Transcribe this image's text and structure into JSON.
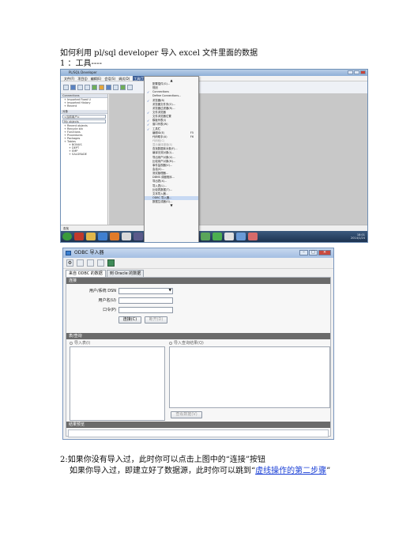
{
  "doc": {
    "title": "如何利用 pl/sql developer  导入 excel 文件里面的数据",
    "step1": "1 ：工具----",
    "step2": "2:如果你没有导入过，此时你可以点击上图中的“连接”按钮",
    "step2b_prefix": "如果你导入过，即建立好了数据源，此时你可以跳到“",
    "step2b_link": "虚线操作的第二步骤",
    "step2b_suffix": "”",
    "link_color": "#1a3fd6"
  },
  "plsql_window": {
    "title": "PL/SQL Developer",
    "menu": [
      "文件(F)",
      "项目(J)",
      "编辑(E)",
      "会话(S)",
      "调试(D)",
      "工具(T)",
      "报告(R)",
      "窗口(W)",
      "帮助(H)"
    ],
    "active_menu": "工具(T)",
    "left_panel": {
      "header": "Connections",
      "tree": [
        "Imported Fixed U",
        "Imported History",
        "Recent"
      ],
      "selector_header": "对象",
      "selector_value": "<当前用户>",
      "objects_header": "My objects",
      "object_tree": [
        "Recent objects",
        "Recycle bin",
        "Functions",
        "Procedures",
        "Packages",
        "Tables",
        "BONUS",
        "DEPT",
        "EMP",
        "SALGRADE"
      ]
    },
    "bottom_bar": "查找",
    "taskbar_time": "18:01",
    "taskbar_date": "2014/1/24",
    "tools_menu": [
      {
        "label": "配置插件(G)...",
        "checked": false
      },
      {
        "label": "规则",
        "checked": false
      },
      {
        "label": "Connections",
        "checked": true
      },
      {
        "label": "Define Connections...",
        "checked": false
      },
      {
        "label": "浏览器(B)",
        "checked": true
      },
      {
        "label": "浏览器文件夹(O)...",
        "checked": false
      },
      {
        "label": "浏览器过滤器(R)...",
        "checked": false
      },
      {
        "label": "文件浏览器",
        "checked": true
      },
      {
        "label": "文件浏览器位置",
        "checked": false
      },
      {
        "label": "模板列表(I)",
        "checked": true
      },
      {
        "label": "窗口列表(W)",
        "checked": true
      },
      {
        "label": "工具栏",
        "checked": true
      },
      {
        "label": "编辑ID(E)",
        "checked": false,
        "key": "F5"
      },
      {
        "label": "代码助手(A)",
        "checked": false,
        "key": "F6"
      },
      {
        "label": "代码段(C)",
        "checked": false,
        "grey": true
      },
      {
        "label": "显示编译错误(S)",
        "checked": false,
        "grey": true
      },
      {
        "label": "查找数据库对象(F)...",
        "checked": false
      },
      {
        "label": "编译无效对象(I)...",
        "checked": false
      },
      {
        "label": "导出用户对象(U)...",
        "checked": false
      },
      {
        "label": "比较用户对象(M)...",
        "checked": false
      },
      {
        "label": "事件监视器(V)...",
        "checked": false
      },
      {
        "label": "会话(S)...",
        "checked": false
      },
      {
        "label": "测试管理器...",
        "checked": false
      },
      {
        "label": "DBMS 调度程序...",
        "checked": false
      },
      {
        "label": "导出表(X)...",
        "checked": false
      },
      {
        "label": "导入表(L)...",
        "checked": false
      },
      {
        "label": "比较表数据(T)...",
        "checked": false
      },
      {
        "label": "文本导入器...",
        "checked": false
      },
      {
        "label": "ODBC 导入器...",
        "checked": false,
        "highlight": true
      },
      {
        "label": "数据生成器(G)...",
        "checked": false
      }
    ]
  },
  "odbc_importer": {
    "title": "ODBC 导入器",
    "tabs": [
      "来自 ODBC 的数据",
      "到 Oracle 的数据"
    ],
    "connection_section": "连接",
    "user_label": "用户/系统 DSN",
    "username_label": "用户名(U)",
    "password_label": "口令(P)",
    "dsn_value": "",
    "connect_button": "连接(C)",
    "disconnect_button": "断开(D)",
    "table_section": "表/查询",
    "import_table_radio": "导入表(I)",
    "import_query_radio": "导入查询结果(Q)",
    "view_data_button": "查看数据(V)",
    "result_section": "结果预览"
  }
}
